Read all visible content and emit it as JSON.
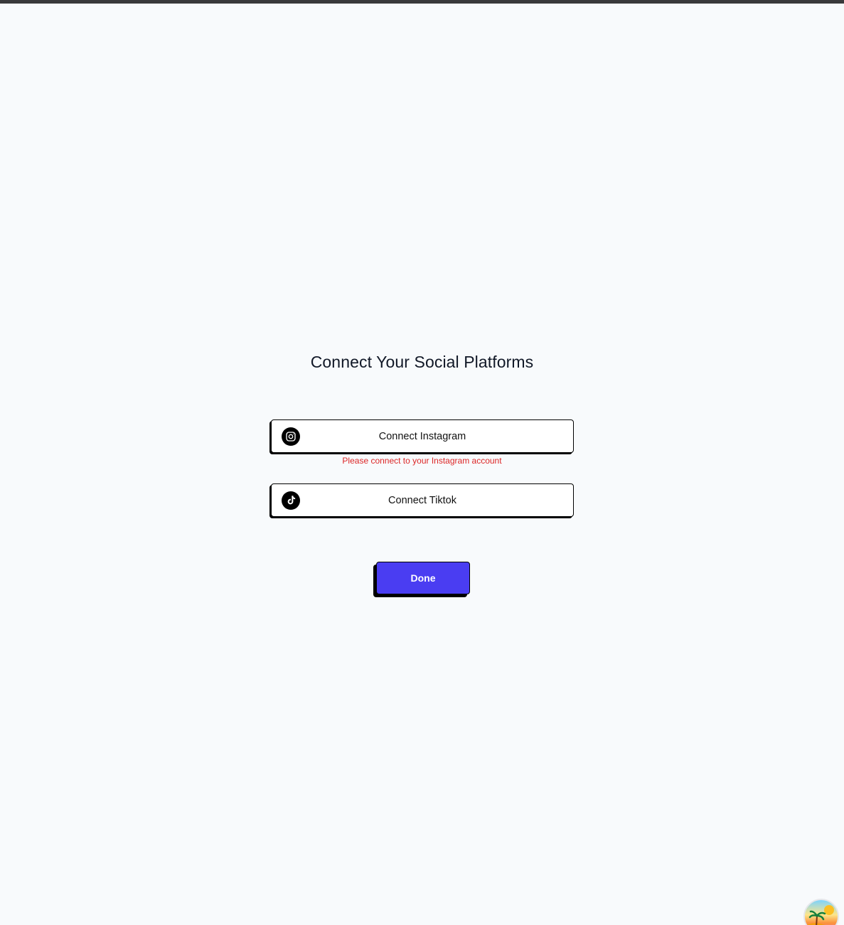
{
  "page": {
    "title": "Connect Your Social Platforms"
  },
  "instagram": {
    "label": "Connect Instagram",
    "icon": "instagram-icon",
    "error": "Please connect to your Instagram account"
  },
  "tiktok": {
    "label": "Connect Tiktok",
    "icon": "tiktok-icon"
  },
  "actions": {
    "done_label": "Done"
  },
  "colors": {
    "background": "#f8fafc",
    "primary": "#4a3df2",
    "error": "#dc2626",
    "border": "#000000"
  }
}
